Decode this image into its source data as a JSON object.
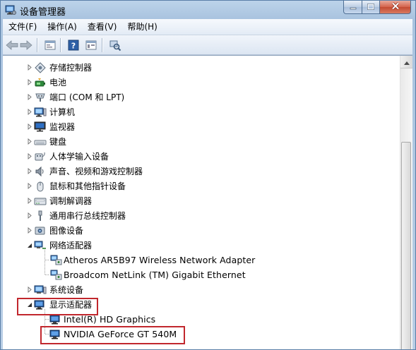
{
  "window": {
    "title": "设备管理器",
    "icons": {
      "app": "device-manager-icon",
      "minimize": "minimize-icon",
      "maximize": "maximize-icon",
      "close": "close-icon"
    }
  },
  "menu": {
    "items": [
      "文件(F)",
      "操作(A)",
      "查看(V)",
      "帮助(H)"
    ]
  },
  "toolbar": {
    "buttons": [
      "back-icon",
      "forward-icon",
      "properties-icon",
      "help-icon",
      "view-icon",
      "scan-hardware-icon"
    ]
  },
  "tree": {
    "items": [
      {
        "label": "存储控制器",
        "icon": "storage-controller-icon",
        "expanded": false
      },
      {
        "label": "电池",
        "icon": "battery-icon",
        "expanded": false
      },
      {
        "label": "端口 (COM 和 LPT)",
        "icon": "port-icon",
        "expanded": false
      },
      {
        "label": "计算机",
        "icon": "computer-icon",
        "expanded": false
      },
      {
        "label": "监视器",
        "icon": "monitor-icon",
        "expanded": false
      },
      {
        "label": "键盘",
        "icon": "keyboard-icon",
        "expanded": false
      },
      {
        "label": "人体学输入设备",
        "icon": "hid-icon",
        "expanded": false
      },
      {
        "label": "声音、视频和游戏控制器",
        "icon": "speaker-icon",
        "expanded": false
      },
      {
        "label": "鼠标和其他指针设备",
        "icon": "mouse-icon",
        "expanded": false
      },
      {
        "label": "调制解调器",
        "icon": "modem-icon",
        "expanded": false
      },
      {
        "label": "通用串行总线控制器",
        "icon": "usb-icon",
        "expanded": false
      },
      {
        "label": "图像设备",
        "icon": "imaging-device-icon",
        "expanded": false
      },
      {
        "label": "网络适配器",
        "icon": "network-adapter-icon",
        "expanded": true,
        "children": [
          "Atheros AR5B97 Wireless Network Adapter",
          "Broadcom NetLink (TM) Gigabit Ethernet"
        ]
      },
      {
        "label": "系统设备",
        "icon": "system-device-icon",
        "expanded": false
      },
      {
        "label": "显示适配器",
        "icon": "display-adapter-icon",
        "expanded": true,
        "highlighted": true,
        "children": [
          "Intel(R) HD Graphics",
          "NVIDIA GeForce GT 540M"
        ]
      }
    ]
  },
  "highlight_color": "#c1272d"
}
